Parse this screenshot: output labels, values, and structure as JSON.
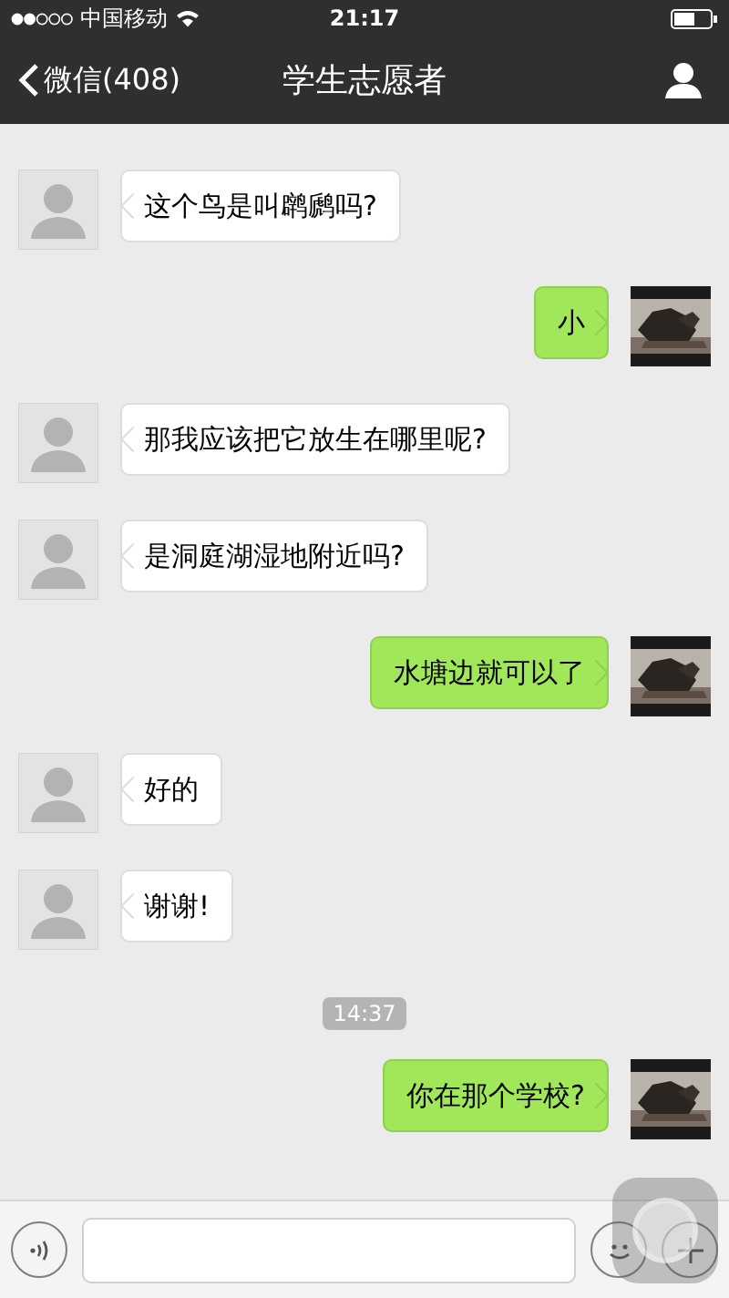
{
  "status_bar": {
    "carrier": "中国移动",
    "time": "21:17"
  },
  "nav": {
    "back_label": "微信(408)",
    "title": "学生志愿者"
  },
  "messages": [
    {
      "kind": "incoming",
      "text": "这个鸟是叫䴙䴘吗?"
    },
    {
      "kind": "outgoing",
      "text": "小"
    },
    {
      "kind": "incoming",
      "text": "那我应该把它放生在哪里呢?"
    },
    {
      "kind": "incoming",
      "text": "是洞庭湖湿地附近吗?"
    },
    {
      "kind": "outgoing",
      "text": "水塘边就可以了"
    },
    {
      "kind": "incoming",
      "text": "好的"
    },
    {
      "kind": "incoming",
      "text": "谢谢!"
    },
    {
      "kind": "time",
      "text": "14:37"
    },
    {
      "kind": "outgoing",
      "text": "你在那个学校?"
    }
  ]
}
